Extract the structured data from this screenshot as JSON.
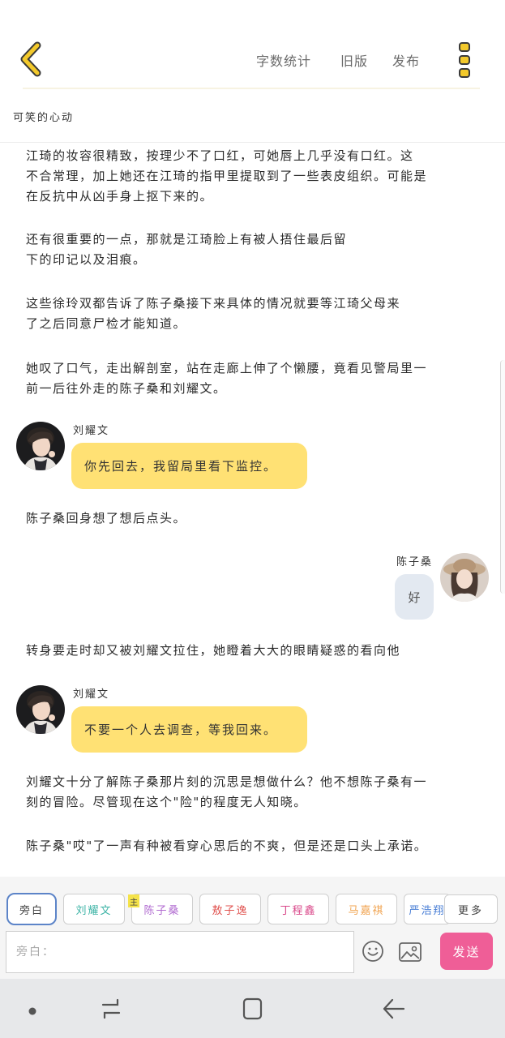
{
  "header": {
    "word_count_label": "字数统计",
    "old_version_label": "旧版",
    "publish_label": "发布"
  },
  "story": {
    "title": "可笑的心动"
  },
  "content": {
    "p1": "江琦的妆容很精致，按理少不了口红，可她唇上几乎没有口红。这\n不合常理，加上她还在江琦的指甲里提取到了一些表皮组织。可能是\n在反抗中从凶手身上抠下来的。",
    "p2": "还有很重要的一点，那就是江琦脸上有被人捂住最后留\n下的印记以及泪痕。",
    "p3": "这些徐玲双都告诉了陈子桑接下来具体的情况就要等江琦父母来\n了之后同意尸检才能知道。",
    "p4": "她叹了口气，走出解剖室，站在走廊上伸了个懒腰，竟看见警局里一\n前一后往外走的陈子桑和刘耀文。",
    "dialog1": {
      "speaker": "刘耀文",
      "text": "你先回去，我留局里看下监控。"
    },
    "p5": "陈子桑回身想了想后点头。",
    "dialog2": {
      "speaker": "陈子桑",
      "text": "好"
    },
    "p6": "转身要走时却又被刘耀文拉住，她瞪着大大的眼睛疑惑的看向他",
    "dialog3": {
      "speaker": "刘耀文",
      "text": "不要一个人去调查，等我回来。"
    },
    "p7": "刘耀文十分了解陈子桑那片刻的沉思是想做什么？他不想陈子桑有一\n刻的冒险。尽管现在这个\"险\"的程度无人知晓。",
    "p8": "陈子桑\"哎\"了一声有种被看穿心思后的不爽，但是还是口头上承诺。"
  },
  "characters": {
    "items": [
      {
        "label": "旁白",
        "color": "#444444"
      },
      {
        "label": "刘耀文",
        "color": "#3bb3a5"
      },
      {
        "label": "陈子桑",
        "color": "#b06ad0"
      },
      {
        "label": "敖子逸",
        "color": "#e0524f"
      },
      {
        "label": "丁程鑫",
        "color": "#d9488a"
      },
      {
        "label": "马嘉祺",
        "color": "#f0a34f"
      },
      {
        "label": "严浩翔",
        "color": "#4a7fd6"
      }
    ],
    "main_tag": "主",
    "more_label": "更多"
  },
  "composer": {
    "placeholder": "旁白：",
    "send_label": "发送"
  },
  "colors": {
    "accent_yellow": "#ffe174",
    "send_pink": "#ef5e97",
    "back_chevron": "#f3c92b"
  }
}
